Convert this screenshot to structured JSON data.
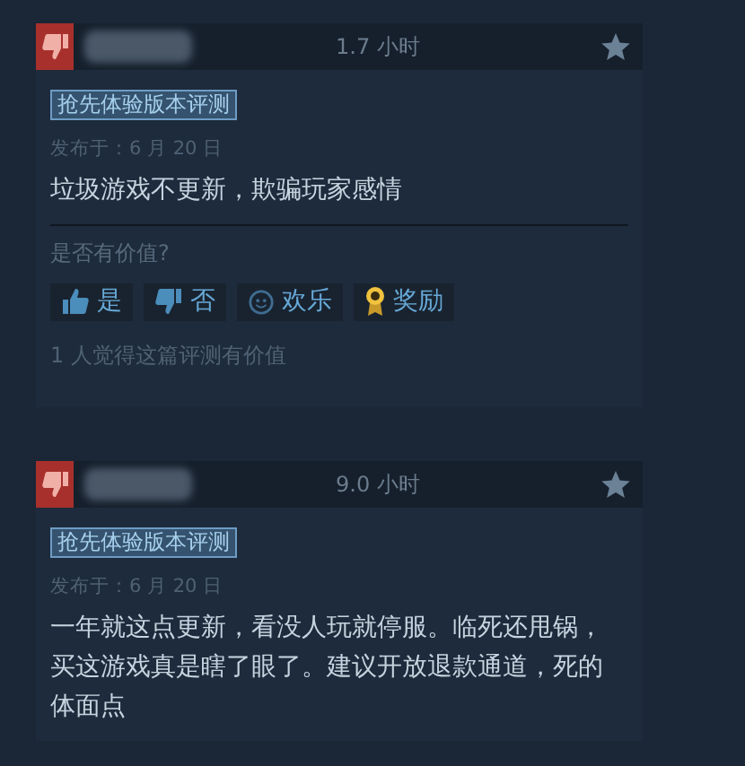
{
  "reviews": [
    {
      "recommended": false,
      "hours": "1.7 小时",
      "tag": "抢先体验版本评测",
      "posted": "发布于：6 月 20 日",
      "text": "垃圾游戏不更新，欺骗玩家感情",
      "helpful_prompt": "是否有价值?",
      "votes": [
        {
          "kind": "yes",
          "label": "是"
        },
        {
          "kind": "no",
          "label": "否"
        },
        {
          "kind": "funny",
          "label": "欢乐"
        },
        {
          "kind": "award",
          "label": "奖励"
        }
      ],
      "helpful_count": "1 人觉得这篇评测有价值"
    },
    {
      "recommended": false,
      "hours": "9.0 小时",
      "tag": "抢先体验版本评测",
      "posted": "发布于：6 月 20 日",
      "text": "一年就这点更新，看没人玩就停服。临死还甩锅，买这游戏真是瞎了眼了。建议开放退款通道，死的体面点"
    }
  ]
}
